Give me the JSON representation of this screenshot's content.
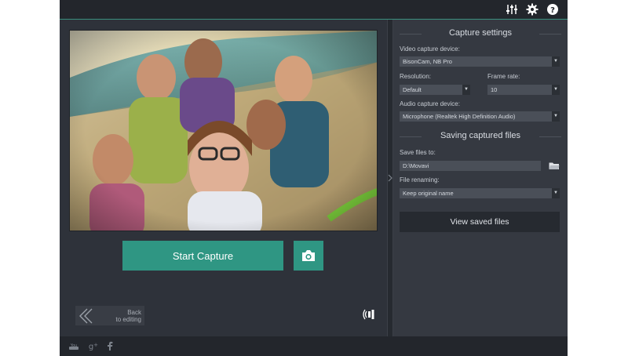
{
  "toolbar": {
    "icons": [
      "equalizer-icon",
      "gear-icon",
      "help-icon"
    ]
  },
  "capture": {
    "start_label": "Start Capture",
    "snapshot_icon": "camera-icon"
  },
  "back": {
    "line1": "Back",
    "line2": "to editing"
  },
  "settings": {
    "capture_title": "Capture settings",
    "video_device_label": "Video capture device:",
    "video_device_value": "BisonCam, NB Pro",
    "resolution_label": "Resolution:",
    "resolution_value": "Default",
    "frame_rate_label": "Frame rate:",
    "frame_rate_value": "10",
    "audio_device_label": "Audio capture device:",
    "audio_device_value": "Microphone (Realtek High Definition Audio)",
    "saving_title": "Saving captured files",
    "save_to_label": "Save files to:",
    "save_to_value": "D:\\Movavi",
    "renaming_label": "File renaming:",
    "renaming_value": "Keep original name",
    "view_saved_label": "View saved files"
  },
  "social": [
    "youtube-icon",
    "google-plus-icon",
    "facebook-icon"
  ],
  "colors": {
    "accent": "#2f9683",
    "panel": "#353941",
    "background": "#2e323a"
  }
}
